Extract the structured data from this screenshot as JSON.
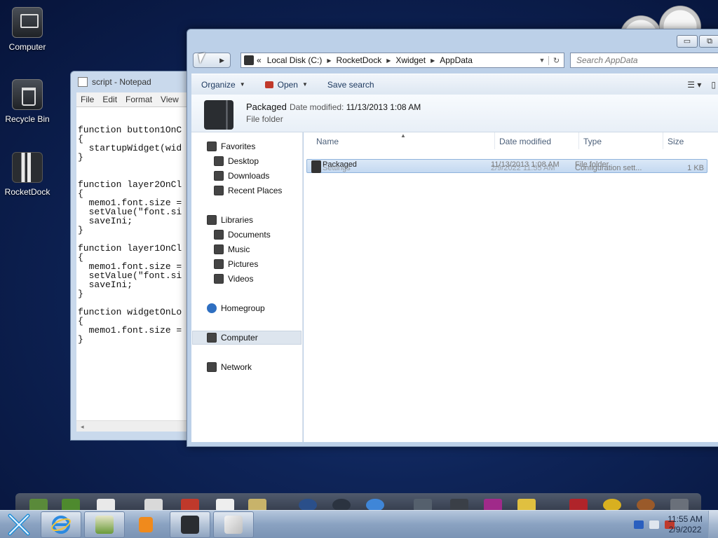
{
  "desktop": {
    "icons": [
      {
        "label": "Computer"
      },
      {
        "label": "Recycle Bin"
      },
      {
        "label": "RocketDock"
      }
    ]
  },
  "notepad": {
    "title": "script - Notepad",
    "menu": [
      "File",
      "Edit",
      "Format",
      "View"
    ],
    "content": "function button1OnC\n{\n  startupWidget(wid\n}\n\n\nfunction layer2OnCl\n{\n  memo1.font.size =\n  setValue(\"font.si\n  saveIni;\n}\n\nfunction layer1OnCl\n{\n  memo1.font.size =\n  setValue(\"font.si\n  saveIni;\n}\n\nfunction widgetOnLo\n{\n  memo1.font.size =\n}"
  },
  "explorer": {
    "controls": {
      "minimize": "▭",
      "maximize": "⧉"
    },
    "address": {
      "chevron": "«",
      "segments": [
        "Local Disk (C:)",
        "RocketDock",
        "Xwidget",
        "AppData"
      ]
    },
    "search": {
      "placeholder": "Search AppData"
    },
    "toolbar": {
      "organize": "Organize",
      "open": "Open",
      "save_search": "Save search"
    },
    "details": {
      "name": "Packaged",
      "date_label": "Date modified:",
      "date_value": "11/13/2013 1:08 AM",
      "type": "File folder"
    },
    "nav": {
      "favorites": "Favorites",
      "desktop": "Desktop",
      "downloads": "Downloads",
      "recent_places": "Recent Places",
      "libraries": "Libraries",
      "documents": "Documents",
      "music": "Music",
      "pictures": "Pictures",
      "videos": "Videos",
      "homegroup": "Homegroup",
      "computer": "Computer",
      "network": "Network"
    },
    "columns": {
      "name": "Name",
      "date": "Date modified",
      "type": "Type",
      "size": "Size"
    },
    "rows": [
      {
        "name": "Packaged",
        "date": "11/13/2013 1:08 AM",
        "type": "File folder",
        "size": ""
      },
      {
        "name": "Settings",
        "date": "2/9/2022 11:55 AM",
        "type": "Configuration sett...",
        "size": "1 KB"
      }
    ]
  },
  "taskbar": {
    "clock": {
      "time": "11:55 AM",
      "date": "2/9/2022"
    }
  }
}
